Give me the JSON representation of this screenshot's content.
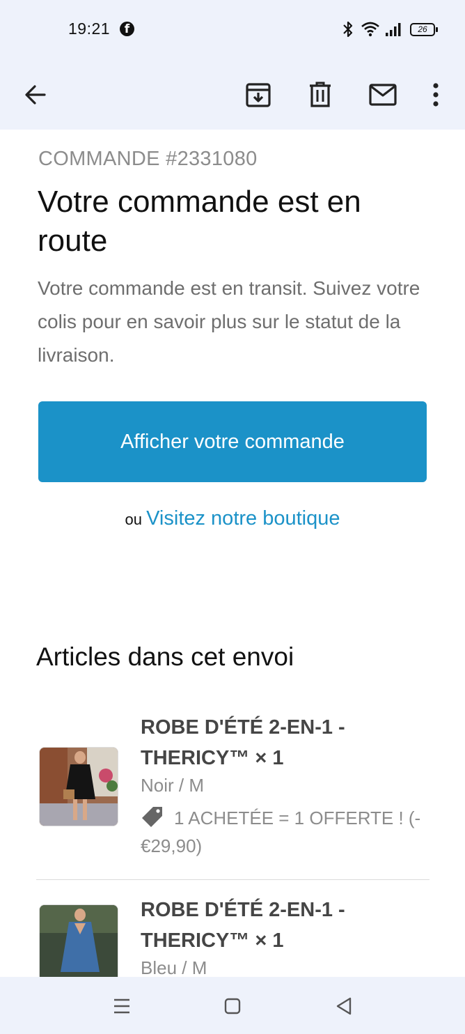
{
  "status_bar": {
    "time": "19:21",
    "battery_level": "26",
    "icons": [
      "facebook-icon",
      "bluetooth-icon",
      "wifi-icon",
      "signal-icon",
      "battery-icon"
    ]
  },
  "toolbar": {
    "icons": [
      "back-arrow-icon",
      "archive-icon",
      "trash-icon",
      "mail-icon",
      "more-vert-icon"
    ]
  },
  "email": {
    "order_number": "COMMANDE #2331080",
    "headline": "Votre commande est en route",
    "intro": "Votre commande est en transit. Suivez votre colis pour en savoir plus sur le statut de la livraison.",
    "cta_label": "Afficher votre commande",
    "or_text": "ou",
    "store_link": "Visitez notre boutique",
    "link_color": "#1b92c8",
    "button_color": "#1b92c8",
    "section_title": "Articles dans cet envoi",
    "items": [
      {
        "title": "ROBE D'ÉTÉ 2-EN-1 - THERICY™ × 1",
        "variant": "Noir / M",
        "discount": "1 ACHETÉE = 1 OFFERTE ! (-€29,90)",
        "image": "black-dress-photo"
      },
      {
        "title": "ROBE D'ÉTÉ 2-EN-1 - THERICY™ × 1",
        "variant": "Bleu / M",
        "image": "blue-dress-photo"
      }
    ]
  },
  "nav_bar": {
    "icons": [
      "recent-apps-icon",
      "home-icon",
      "back-triangle-icon"
    ]
  }
}
